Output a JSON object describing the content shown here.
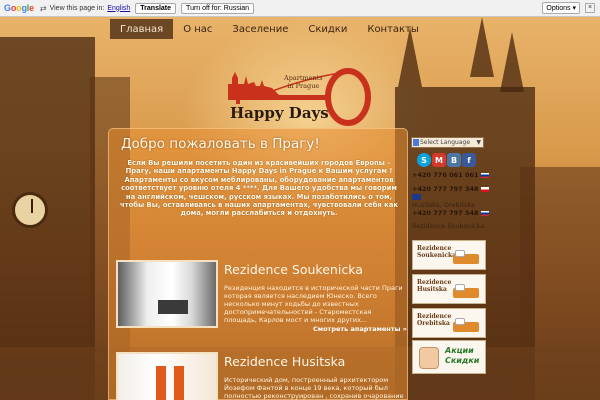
{
  "translate_bar": {
    "logo_letters": [
      "G",
      "o",
      "o",
      "g",
      "l",
      "e"
    ],
    "prompt": "View this page in:",
    "language": "English",
    "translate_btn": "Translate",
    "turn_off_btn": "Turn off for: Russian",
    "options_btn": "Options ▾",
    "close": "×"
  },
  "nav": {
    "items": [
      "Главная",
      "О нас",
      "Заселение",
      "Скидки",
      "Контакты"
    ],
    "active_index": 0
  },
  "logo": {
    "apartments": "Apartments",
    "in_prague": "in Prague",
    "title": "Happy Days"
  },
  "welcome": {
    "title": "Добро пожаловать в Прагу!",
    "text": "Если Вы решили посетить один из красивейших городов Европы – Прагу, наши апартаменты Happy Days in Prague к Вашим услугам ! Апартаменты со вкусом меблированы, оборудование апартаментов соответствует уровню отеля 4 ****. Для Вашего удобства мы говорим на английском, чешском, русском языках. Мы позаботились о том, чтобы Вы, оставливаясь в наших апартаментах, чувствовали себя как дома, могли расслабиться и отдохнуть."
  },
  "articles": [
    {
      "title": "Rezidence Soukenicka",
      "text": "Резиденция находится в исторической части Праги которая является наследием Юнеско. Всего несколько минут ходьбы до известных достопримечательностей - Староместская площадь, Карлов мост и многих других...",
      "more": "Смотреть апартаменты »"
    },
    {
      "title": "Rezidence Husitska",
      "text": "Исторический дом, построенный архитектором Йозефом Фантой в конце 19 века, который был полностью реконструирован , сохранив очарование и"
    }
  ],
  "sidebar": {
    "select_language": "Select Language",
    "select_arrow": "▼",
    "social": [
      "S",
      "M",
      "В",
      "f"
    ],
    "phones": [
      "+420 776 061 061",
      "+420 777 797 348",
      "Husitska, Orebitska",
      "+420 777 797 548",
      "Rezidence Soukenicka"
    ],
    "banners": [
      {
        "line1": "Rezidence",
        "line2": "Soukenicka"
      },
      {
        "line1": "Rezidence",
        "line2": "Husitska"
      },
      {
        "line1": "Rezidence",
        "line2": "Orebitska"
      }
    ],
    "promo": {
      "line1": "Акции",
      "line2": "Скидки"
    }
  }
}
